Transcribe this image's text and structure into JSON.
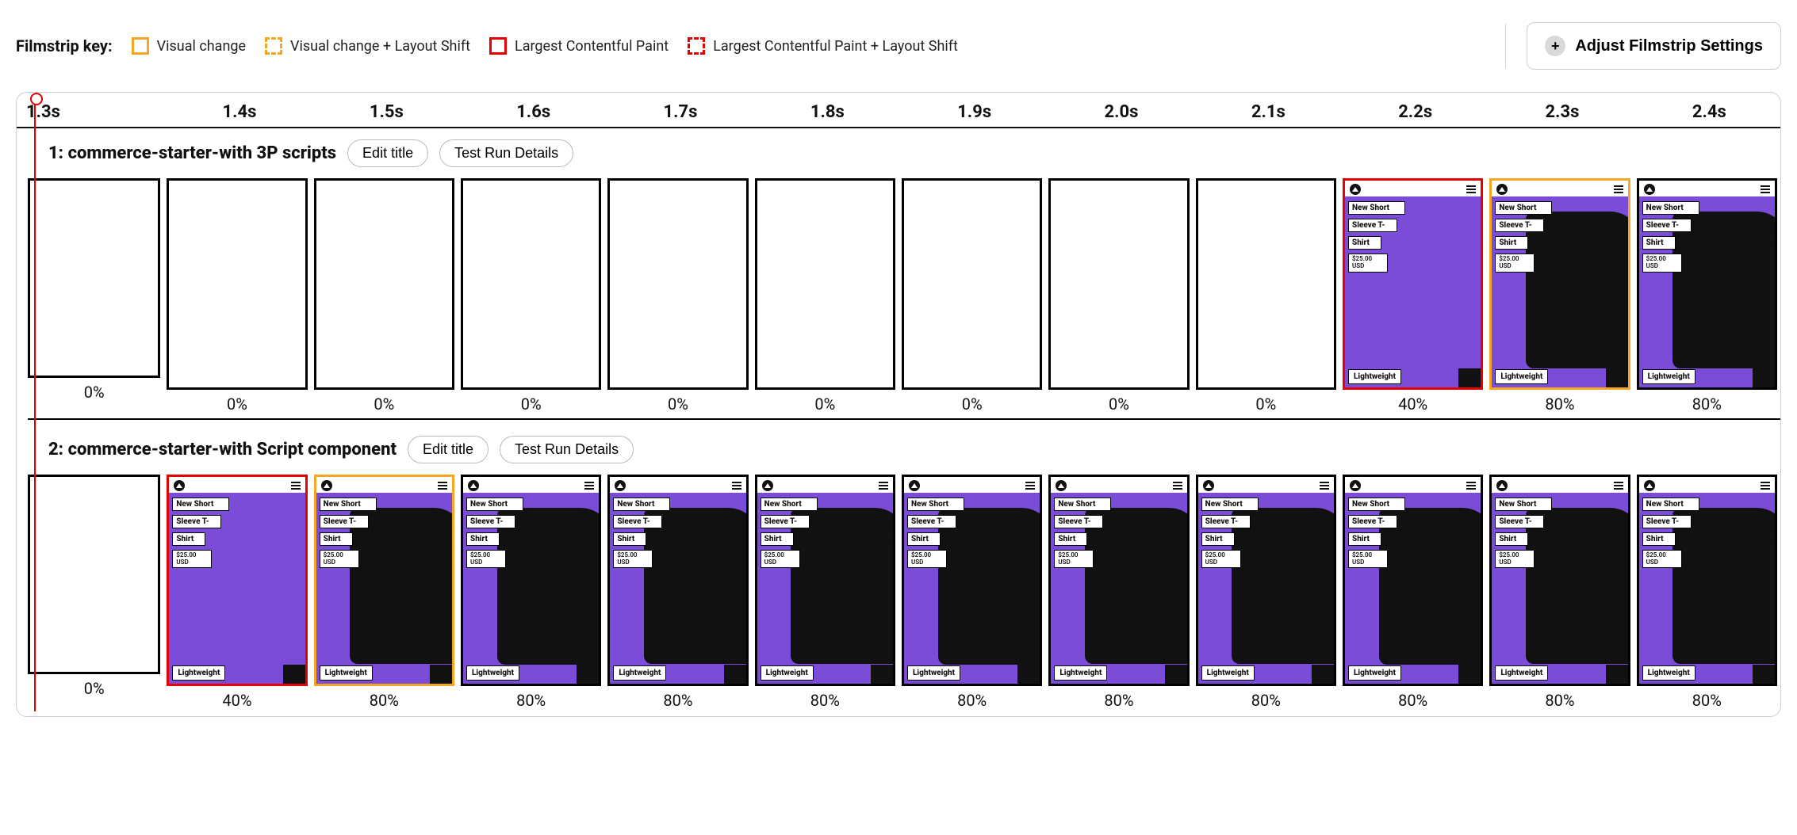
{
  "header": {
    "key_title": "Filmstrip key:",
    "items": [
      "Visual change",
      "Visual change + Layout Shift",
      "Largest Contentful Paint",
      "Largest Contentful Paint + Layout Shift"
    ],
    "adjust_label": "Adjust Filmstrip Settings"
  },
  "timeline": {
    "ticks": [
      "1.3s",
      "1.4s",
      "1.5s",
      "1.6s",
      "1.7s",
      "1.8s",
      "1.9s",
      "2.0s",
      "2.1s",
      "2.2s",
      "2.3s",
      "2.4s"
    ]
  },
  "buttons": {
    "edit_title": "Edit title",
    "test_run_details": "Test Run Details"
  },
  "product": {
    "line1": "New Short",
    "line2": "Sleeve T-",
    "line3": "Shirt",
    "price": "$25.00 USD",
    "badge": "Lightweight"
  },
  "runs": [
    {
      "title": "1: commerce-starter-with 3P scripts",
      "frames": [
        {
          "pct": "0%",
          "content": "blank",
          "border": "black"
        },
        {
          "pct": "0%",
          "content": "blank",
          "border": "black"
        },
        {
          "pct": "0%",
          "content": "blank",
          "border": "black"
        },
        {
          "pct": "0%",
          "content": "blank",
          "border": "black"
        },
        {
          "pct": "0%",
          "content": "blank",
          "border": "black"
        },
        {
          "pct": "0%",
          "content": "blank",
          "border": "black"
        },
        {
          "pct": "0%",
          "content": "blank",
          "border": "black"
        },
        {
          "pct": "0%",
          "content": "blank",
          "border": "black"
        },
        {
          "pct": "0%",
          "content": "blank",
          "border": "black"
        },
        {
          "pct": "40%",
          "content": "partial",
          "border": "lcp"
        },
        {
          "pct": "80%",
          "content": "full",
          "border": "vc"
        },
        {
          "pct": "80%",
          "content": "full",
          "border": "black"
        }
      ]
    },
    {
      "title": "2: commerce-starter-with Script component",
      "frames": [
        {
          "pct": "0%",
          "content": "blank",
          "border": "black"
        },
        {
          "pct": "40%",
          "content": "partial",
          "border": "lcp"
        },
        {
          "pct": "80%",
          "content": "full",
          "border": "vc"
        },
        {
          "pct": "80%",
          "content": "full",
          "border": "black"
        },
        {
          "pct": "80%",
          "content": "full",
          "border": "black"
        },
        {
          "pct": "80%",
          "content": "full",
          "border": "black"
        },
        {
          "pct": "80%",
          "content": "full",
          "border": "black"
        },
        {
          "pct": "80%",
          "content": "full",
          "border": "black"
        },
        {
          "pct": "80%",
          "content": "full",
          "border": "black"
        },
        {
          "pct": "80%",
          "content": "full",
          "border": "black"
        },
        {
          "pct": "80%",
          "content": "full",
          "border": "black"
        },
        {
          "pct": "80%",
          "content": "full",
          "border": "black"
        }
      ]
    }
  ]
}
